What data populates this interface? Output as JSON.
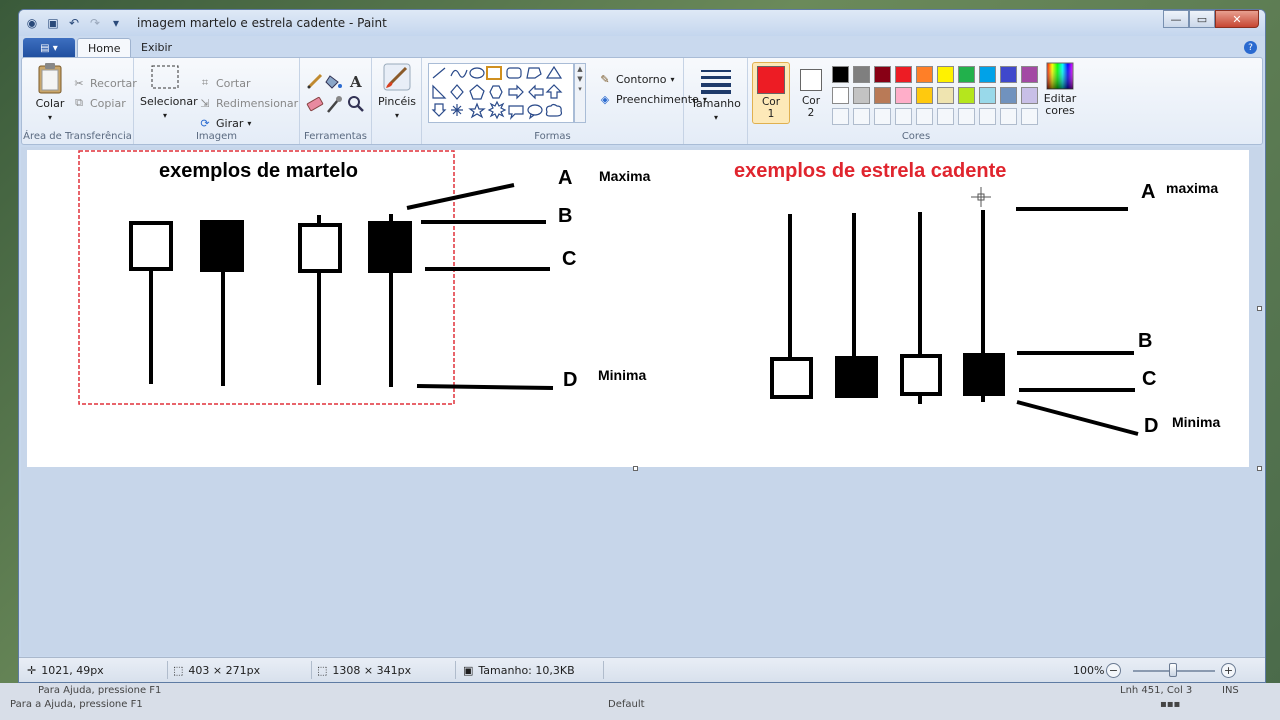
{
  "window": {
    "title": "imagem martelo e estrela cadente - Paint"
  },
  "tabs": {
    "home": "Home",
    "view": "Exibir"
  },
  "clipboard": {
    "paste": "Colar",
    "cut": "Recortar",
    "copy": "Copiar",
    "label": "Área de Transferência"
  },
  "image": {
    "select": "Selecionar",
    "crop": "Cortar",
    "resize": "Redimensionar",
    "rotate": "Girar",
    "label": "Imagem"
  },
  "tools": {
    "label": "Ferramentas"
  },
  "brushes": {
    "label": "Pincéis"
  },
  "shapes": {
    "outline": "Contorno",
    "fill": "Preenchimento",
    "label": "Formas"
  },
  "size": {
    "label": "Tamanho"
  },
  "colors": {
    "color1": "Cor 1",
    "color2": "Cor 2",
    "edit": "Editar cores",
    "label": "Cores",
    "color1_value": "#ed1c24",
    "color2_value": "#ffffff",
    "palette_row1": [
      "#000000",
      "#7f7f7f",
      "#880015",
      "#ed1c24",
      "#ff7f27",
      "#fff200",
      "#22b14c",
      "#00a2e8",
      "#3f48cc",
      "#a349a4"
    ],
    "palette_row2": [
      "#ffffff",
      "#c3c3c3",
      "#b97a57",
      "#ffaec9",
      "#ffc90e",
      "#efe4b0",
      "#b5e61d",
      "#99d9ea",
      "#7092be",
      "#c8bfe7"
    ]
  },
  "drawing": {
    "hammer_title": "exemplos de martelo",
    "star_title": "exemplos de estrela cadente",
    "hammer_labels": {
      "a": "A",
      "a_text": "Maxima",
      "b": "B",
      "c": "C",
      "d": "D",
      "d_text": "Minima"
    },
    "star_labels": {
      "a": "A",
      "a_text": "maxima",
      "b": "B",
      "c": "C",
      "d": "D",
      "d_text": "Minima"
    }
  },
  "status": {
    "cursor": "1021, 49px",
    "selection": "403 × 271px",
    "canvas_size": "1308 × 341px",
    "file_size": "Tamanho: 10,3KB",
    "zoom": "100%"
  },
  "background_window": {
    "help": "Para Ajuda, pressione F1",
    "position": "Lnh 451, Col 3",
    "mode": "INS",
    "help2": "Para a Ajuda, pressione F1",
    "default": "Default"
  }
}
